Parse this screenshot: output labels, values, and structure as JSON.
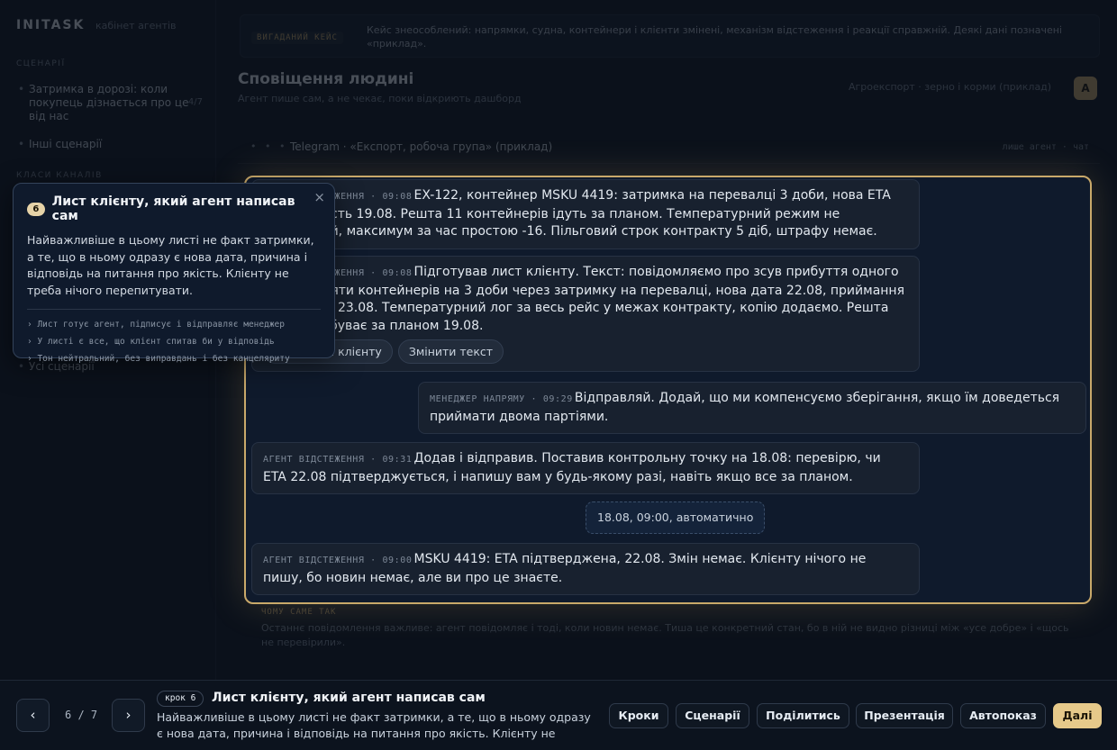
{
  "app": {
    "brand": "INITASK",
    "brand_sub": "кабінет агентів"
  },
  "sidebar": {
    "section_scenarios": "СЦЕНАРІЇ",
    "items": [
      {
        "label": "Затримка в дорозі: коли покупець дізнається про це від нас",
        "count": "4/7"
      },
      {
        "label": "Інші сценарії"
      }
    ],
    "section_2": "КЛАСИ КАНАЛІВ",
    "all_label": "Усі сценарії"
  },
  "banner": {
    "label": "ВИГАДАНИЙ КЕЙС",
    "text": "Кейс знеособлений: напрямки, судна, контейнери і клієнти змінені, механізм відстеження і реакції справжній. Деякі дані позначені «приклад»."
  },
  "page": {
    "title": "Сповіщення людині",
    "subtitle": "Агент пише сам, а не чекає, поки відкриють дашборд",
    "right_text": "Агроекспорт · зерно і корми (приклад)",
    "avatar": "А"
  },
  "thread": {
    "dots": "• • •",
    "name": "Telegram · «Експорт, робоча група» (приклад)",
    "right": "лише агент · чат"
  },
  "messages": [
    {
      "sender": "АГЕНТ ВІДСТЕЖЕННЯ",
      "time": "09:08",
      "text": "EX-122, контейнер MSKU 4419: затримка на перевалці 3 доби, нова ETA 22.08 замість 19.08. Решта 11 контейнерів ідуть за планом. Температурний режим не порушений, максимум за час простою -16. Пільговий строк контракту 5 діб, штрафу немає."
    },
    {
      "sender": "АГЕНТ ВІДСТЕЖЕННЯ",
      "time": "09:08",
      "text": "Підготував лист клієнту. Текст: повідомляємо про зсув прибуття одного з дванадцяти контейнерів на 3 доби через затримку на перевалці, нова дата 22.08, приймання можливе з 23.08. Температурний лог за весь рейс у межах контракту, копію додаємо. Решта партії прибуває за планом 19.08.",
      "actions": [
        "Надіслати клієнту",
        "Змінити текст"
      ]
    },
    {
      "sender": "МЕНЕДЖЕР НАПРЯМУ",
      "time": "09:29",
      "text": "Відправляй. Додай, що ми компенсуємо зберігання, якщо їм доведеться приймати двома партіями."
    },
    {
      "sender": "АГЕНТ ВІДСТЕЖЕННЯ",
      "time": "09:31",
      "text": "Додав і відправив. Поставив контрольну точку на 18.08: перевірю, чи ETA 22.08 підтверджується, і напишу вам у будь-якому разі, навіть якщо все за планом."
    },
    {
      "sender": "АГЕНТ ВІДСТЕЖЕННЯ",
      "time": "09:00",
      "text": "MSKU 4419: ETA підтверджена, 22.08. Змін немає. Клієнту нічого не пишу, бо новин немає, але ви про це знаєте."
    }
  ],
  "system_note": "18.08, 09:00, автоматично",
  "below": {
    "label": "ЧОМУ САМЕ ТАК",
    "text": "Останнє повідомлення важливе: агент повідомляє і тоді, коли новин немає. Тиша це конкретний стан, бо в ній не видно різниці між «усе добре» і «щось не перевірили»."
  },
  "tooltip": {
    "badge": "6",
    "title": "Лист клієнту, який агент написав сам",
    "body": "Найважливіше в цьому листі не факт затримки, а те, що в ньому одразу є нова дата, причина і відповідь на питання про якість. Клієнту не треба нічого перепитувати.",
    "bullets": [
      "› Лист готує агент, підписує і відправляє менеджер",
      "› У листі є все, що клієнт спитав би у відповідь",
      "› Тон нейтральний, без виправдань і без канцеляриту"
    ],
    "close": "×"
  },
  "footer": {
    "prev": "‹",
    "next": "›",
    "counter": "6 / 7",
    "step_badge": "крок 6",
    "step_title": "Лист клієнту, який агент написав сам",
    "step_desc": "Найважливіше в цьому листі не факт затримки, а те, що в ньому одразу є нова дата, причина і відповідь на питання про якість. Клієнту не треба…",
    "buttons": {
      "steps": "Кроки",
      "scenarios": "Сценарії",
      "share": "Поділитись",
      "presentation": "Презентація",
      "autoplay": "Автопоказ",
      "next": "Далі"
    }
  },
  "colors": {
    "accent": "#c9a96a",
    "primary_button": "#e6c98a",
    "panel": "#0f1a2c",
    "background": "#0b111b"
  },
  "icons": {
    "close": "close-icon",
    "prev": "chevron-left-icon",
    "next": "chevron-right-icon"
  }
}
